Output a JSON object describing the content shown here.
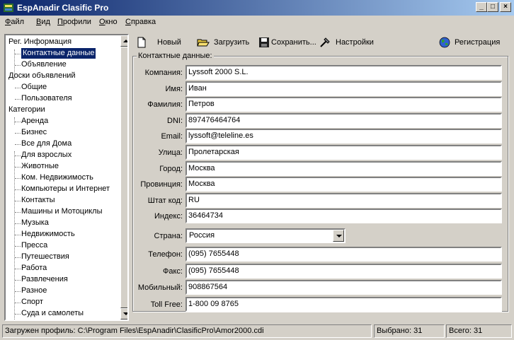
{
  "window": {
    "title": "EspAnadir Clasific Pro",
    "controls": [
      "_",
      "□",
      "×"
    ]
  },
  "menu": [
    {
      "label": "Файл",
      "accel": "Ф",
      "rest": "айл"
    },
    {
      "label": "Вид",
      "accel": "В",
      "rest": "ид"
    },
    {
      "label": "Профили",
      "accel": "П",
      "rest": "рофили"
    },
    {
      "label": "Окно",
      "accel": "О",
      "rest": "кно"
    },
    {
      "label": "Справка",
      "accel": "С",
      "rest": "правка"
    }
  ],
  "toolbar": {
    "new_label": "Новый",
    "load_label": "Загрузить",
    "save_label": "Сохранить...",
    "settings_label": "Настройки",
    "register_label": "Регистрация"
  },
  "tree": {
    "nodes": [
      {
        "label": "Рег. Информация",
        "level": 0
      },
      {
        "label": "Контактные данные",
        "level": 1,
        "selected": true
      },
      {
        "label": "Объявление",
        "level": 1
      },
      {
        "label": "Доски объявлений",
        "level": 0
      },
      {
        "label": "Общие",
        "level": 1
      },
      {
        "label": "Пользователя",
        "level": 1
      },
      {
        "label": "Категории",
        "level": 0
      },
      {
        "label": "Аренда",
        "level": 1
      },
      {
        "label": "Бизнес",
        "level": 1
      },
      {
        "label": "Все для Дома",
        "level": 1
      },
      {
        "label": "Для взрослых",
        "level": 1
      },
      {
        "label": "Животные",
        "level": 1
      },
      {
        "label": "Ком. Недвижимость",
        "level": 1
      },
      {
        "label": "Компьютеры и Интернет",
        "level": 1
      },
      {
        "label": "Контакты",
        "level": 1
      },
      {
        "label": "Машины и Мотоциклы",
        "level": 1
      },
      {
        "label": "Музыка",
        "level": 1
      },
      {
        "label": "Недвижимость",
        "level": 1
      },
      {
        "label": "Пресса",
        "level": 1
      },
      {
        "label": "Путешествия",
        "level": 1
      },
      {
        "label": "Работа",
        "level": 1
      },
      {
        "label": "Развлечения",
        "level": 1
      },
      {
        "label": "Разное",
        "level": 1
      },
      {
        "label": "Спорт",
        "level": 1
      },
      {
        "label": "Суда и самолеты",
        "level": 1
      }
    ]
  },
  "contact": {
    "group_title": "Контактные данные:",
    "fields": [
      {
        "label": "Компания:",
        "value": "Lyssoft 2000 S.L."
      },
      {
        "label": "Имя:",
        "value": "Иван"
      },
      {
        "label": "Фамилия:",
        "value": "Петров"
      },
      {
        "label": "DNI:",
        "value": "897476464764"
      },
      {
        "label": "Email:",
        "value": "lyssoft@teleline.es"
      },
      {
        "label": "Улица:",
        "value": "Пролетарская"
      },
      {
        "label": "Город:",
        "value": "Москва"
      },
      {
        "label": "Провинция:",
        "value": "Москва"
      },
      {
        "label": "Штат код:",
        "value": "RU"
      },
      {
        "label": "Индекс:",
        "value": "36464734"
      }
    ],
    "country": {
      "label": "Страна:",
      "value": "Россия"
    },
    "fields2": [
      {
        "label": "Телефон:",
        "value": "(095) 7655448"
      },
      {
        "label": "Факс:",
        "value": "(095) 7655448"
      },
      {
        "label": "Мобильный:",
        "value": "908867564"
      },
      {
        "label": "Toll Free:",
        "value": "1-800 09 8765"
      }
    ]
  },
  "status": {
    "profile": "Загружен профиль: C:\\Program Files\\EspAnadir\\ClasificPro\\Amor2000.cdi",
    "selected": "Выбрано: 31",
    "total": "Всего: 31"
  }
}
